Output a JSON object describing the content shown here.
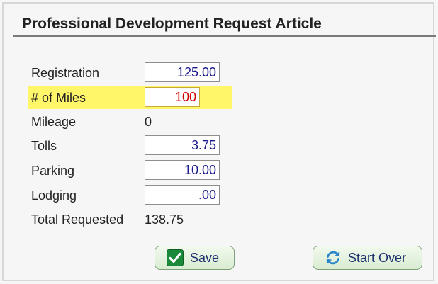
{
  "title": "Professional Development Request Article",
  "rows": {
    "registration": {
      "label": "Registration",
      "value": "125.00"
    },
    "miles": {
      "label": "# of Miles",
      "value": "100"
    },
    "mileage": {
      "label": "Mileage",
      "value": "0"
    },
    "tolls": {
      "label": "Tolls",
      "value": "3.75"
    },
    "parking": {
      "label": "Parking",
      "value": "10.00"
    },
    "lodging": {
      "label": "Lodging",
      "value": ".00"
    },
    "total": {
      "label": "Total Requested",
      "value": "138.75"
    }
  },
  "buttons": {
    "save": {
      "label": "Save",
      "icon": "checkmark-icon"
    },
    "start_over": {
      "label": "Start Over",
      "icon": "refresh-icon"
    }
  },
  "colors": {
    "highlight": "#fff66a",
    "active_value": "#d00000",
    "field_value": "#1a1a8c",
    "button_bg": "#d8ecd1",
    "check_icon_bg": "#1a8a3a",
    "refresh_icon": "#2a86c8"
  }
}
